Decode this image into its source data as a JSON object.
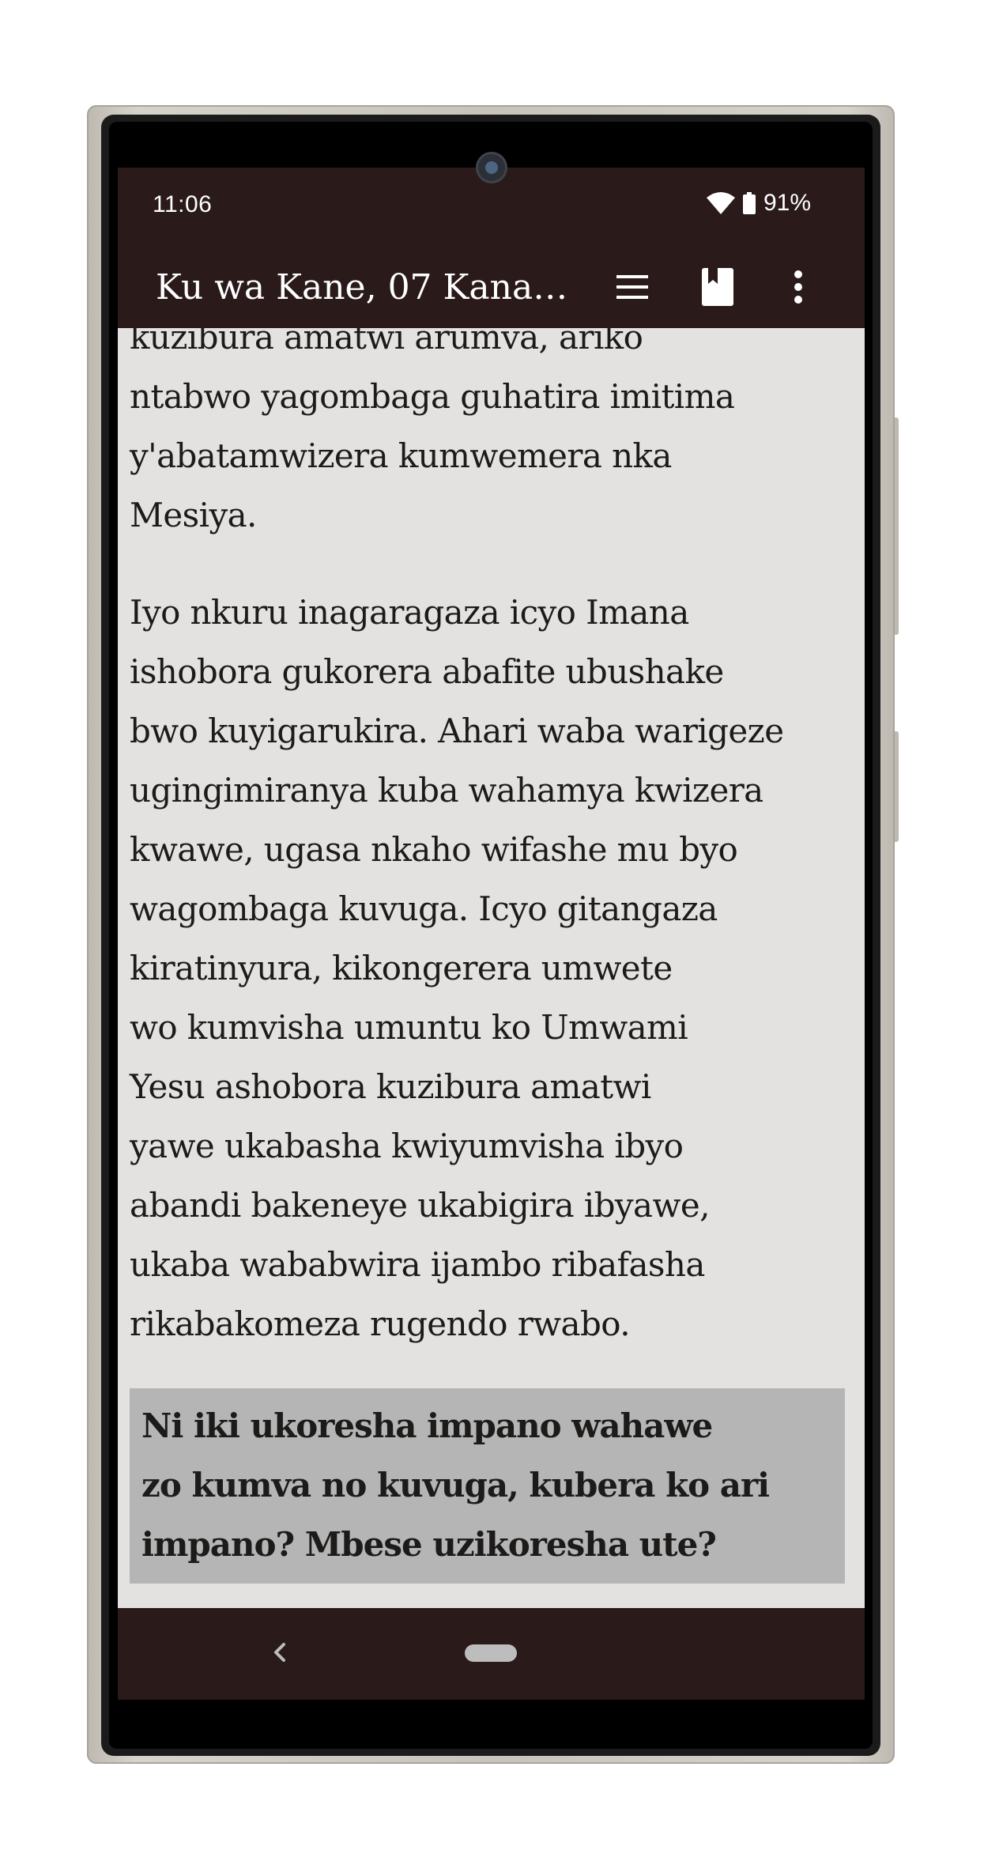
{
  "status_bar": {
    "time": "11:06",
    "battery": "91%"
  },
  "app_bar": {
    "title": "Ku wa Kane, 07 Kanam…",
    "icons": [
      "menu-icon",
      "bookmark-icon",
      "more-vert-icon"
    ]
  },
  "content": {
    "paragraphs": [
      {
        "lines": [
          "kuzibura amatwi arumva, ariko",
          "ntabwo yagombaga guhatira imitima",
          "y'abatamwizera kumwemera nka",
          "Mesiya."
        ]
      },
      {
        "lines": [
          "Iyo nkuru inagaragaza icyo Imana",
          "ishobora gukorera abafite ubushake",
          "bwo kuyigarukira. Ahari waba warigeze",
          "ugingimiranya kuba wahamya kwizera",
          "kwawe, ugasa nkaho wifashe mu byo",
          "wagombaga kuvuga. Icyo gitangaza",
          "kiratinyura, kikongerera umwete",
          "wo kumvisha umuntu ko Umwami",
          "Yesu ashobora kuzibura amatwi",
          "yawe ukabasha kwiyumvisha ibyo",
          "abandi bakeneye ukabigira ibyawe,",
          "ukaba wababwira ijambo ribafasha",
          "rikabakomeza rugendo rwabo."
        ]
      }
    ],
    "question": {
      "lines": [
        "Ni iki ukoresha impano wahawe",
        "zo kumva no kuvuga, kubera ko ari",
        "impano? Mbese uzikoresha ute?"
      ]
    }
  },
  "nav_bar": {
    "icons": [
      "back-icon",
      "home-pill"
    ]
  },
  "colors": {
    "app_bar_bg": "#2a1a1a",
    "content_bg": "#e3e2e1",
    "question_bg": "#b5b5b5",
    "text": "#1c1b1a"
  }
}
